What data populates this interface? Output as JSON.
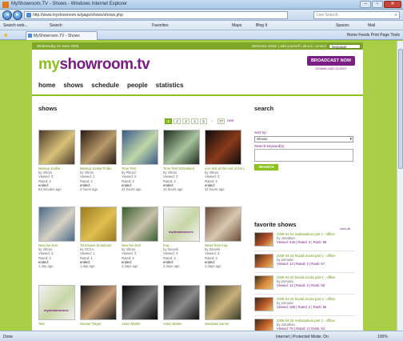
{
  "window": {
    "title": "MyShowroom.TV - Shows - Windows Internet Explorer",
    "address": "http://www.myshowroom.tv/page/shows/shows.php",
    "search_placeholder": "Live Search",
    "tab_label": "MyShowroom.TV - Shows",
    "toolbar_items": [
      "Search web...",
      "Search",
      "Favorites",
      "Maps",
      "Blog It",
      "Spaces",
      "Mail"
    ],
    "tab_commands": "Home  Feeds  Print  Page  Tools",
    "status_left": "Done",
    "status_zone": "Internet | Protected Mode: On",
    "status_zoom": "100%"
  },
  "site": {
    "top_strip_date": "Wednesday 04 June 2008",
    "top_strip_links": "Welcome visitor | add yourself | about | contact",
    "language": "language",
    "logo_my": "my",
    "logo_rest": "showroom.tv",
    "broadcast_label": "BROADCAST NOW",
    "broadcast_sub": "DOWNLOAD CLIENT",
    "nav": [
      "home",
      "shows",
      "schedule",
      "people",
      "statistics"
    ]
  },
  "shows": {
    "heading": "shows",
    "pager": [
      "1",
      "2",
      "3",
      "4",
      "5",
      "...",
      "77",
      "next"
    ],
    "current_page": "1",
    "items": [
      {
        "title": "Meetup Junkie",
        "by": "by Viltoro",
        "views": "Viewed: 3",
        "rated": "Rated: 2",
        "status": "ended:",
        "when": "53 minutes ago",
        "colors": [
          "#4c3a2a",
          "#d9c27a"
        ]
      },
      {
        "title": "Meetup Junkie Probe",
        "by": "by Viltoro",
        "views": "Viewed: 1",
        "rated": "Rated: 2",
        "status": "ended:",
        "when": "2 hours ago",
        "colors": [
          "#2c1b14",
          "#b79a6a"
        ]
      },
      {
        "title": "Time Test",
        "by": "by Pikoyz",
        "views": "Viewed: 0",
        "rated": "Rated: 2",
        "status": "ended:",
        "when": "22 hours ago",
        "colors": [
          "#3a5a8a",
          "#c0d6a8"
        ]
      },
      {
        "title": "Time Test Scheduled",
        "by": "by Viltoro",
        "views": "Viewed: 3",
        "rated": "Rated: 2",
        "status": "ended:",
        "when": "22 hours ago",
        "colors": [
          "#1f2a1e",
          "#a7c49d"
        ]
      },
      {
        "title": "Live test at the end of the day",
        "by": "by Viltoro",
        "views": "Viewed: 3",
        "rated": "Rated: 2",
        "status": "ended:",
        "when": "22 hours ago",
        "colors": [
          "#0d0d0d",
          "#8a3a1a"
        ]
      },
      {
        "title": "New live test",
        "by": "by Viltoro",
        "views": "Viewed: 2",
        "rated": "Rated: 2",
        "status": "ended:",
        "when": "1 day ago",
        "colors": [
          "#4a6a8a",
          "#d7d2c4"
        ]
      },
      {
        "title": "Tourniquet broadcast",
        "by": "by OCCA",
        "views": "Viewed: 1",
        "rated": "Rated: 1",
        "status": "ended:",
        "when": "1 day ago",
        "colors": [
          "#9a7a20",
          "#e0c050"
        ]
      },
      {
        "title": "New live test",
        "by": "by Viltoro",
        "views": "Viewed: 3",
        "rated": "Rated: 2",
        "status": "ended:",
        "when": "2 days ago",
        "colors": [
          "#3a6030",
          "#c6c0a8"
        ]
      },
      {
        "title": "Iraq",
        "by": "by Zanvrik",
        "views": "Viewed: 3",
        "rated": "Rated: 2",
        "status": "ended:",
        "when": "2 days ago",
        "colors": [
          "#f2f2f2",
          "#c8d6a6"
        ]
      },
      {
        "title": "News from Iraq",
        "by": "by Zanvrik",
        "views": "Viewed: 3",
        "rated": "Rated: 2",
        "status": "ended:",
        "when": "2 days ago",
        "colors": [
          "#6a4a3a",
          "#d9c9b0"
        ]
      },
      {
        "title": "Test",
        "by": "",
        "views": "",
        "rated": "",
        "status": "",
        "when": "",
        "colors": [
          "#f2f2f2",
          "#c8d6a6"
        ]
      },
      {
        "title": "Human Target",
        "by": "",
        "views": "",
        "rated": "",
        "status": "",
        "when": "",
        "colors": [
          "#1a1a1a",
          "#c9a07a"
        ]
      },
      {
        "title": "Aston Martin",
        "by": "",
        "views": "",
        "rated": "",
        "status": "",
        "when": "",
        "colors": [
          "#0a0a0a",
          "#7a7a7a"
        ]
      },
      {
        "title": "Aston Martin",
        "by": "",
        "views": "",
        "rated": "",
        "status": "",
        "when": "",
        "colors": [
          "#141414",
          "#8a8a8a"
        ]
      },
      {
        "title": "Windows Server",
        "by": "",
        "views": "",
        "rated": "",
        "status": "",
        "when": "",
        "colors": [
          "#3a3a2a",
          "#c8b07a"
        ]
      }
    ],
    "placeholder_label": "myshowroom.tv"
  },
  "sidebar": {
    "search_heading": "search",
    "sort_label": "Sort by:",
    "select_value": "Shows",
    "keywords_label": "Search keyword(s)",
    "search_button": "SEARCH",
    "favorite_heading": "favorite shows",
    "view_all": "view all",
    "favorites": [
      {
        "name": "2008-04-24 multistadium part 1 - offline",
        "by": "by Jonathan",
        "stats": "Viewed: 446 | Rated: 3 | Rank: 58",
        "color": "#b5502a"
      },
      {
        "name": "2008-04-24 feudal clocks part 1 - offline",
        "by": "by jormusic",
        "stats": "Viewed: 13 | Rated: 2 | Rank: 57",
        "color": "#c66a30"
      },
      {
        "name": "2008-04-25 feudal clocks part 2 - offline",
        "by": "by jormusic",
        "stats": "Viewed: 13 | Rated: 2 | Rank: 56",
        "color": "#d8883a"
      },
      {
        "name": "2008-04-25 feudal clocks part 3 - offline",
        "by": "by jormusic",
        "stats": "Viewed: 188 | Rated: 2 | Rank: 55",
        "color": "#b95a28"
      },
      {
        "name": "2008-04-26 multistadium part 2 - offline",
        "by": "by Jonathan",
        "stats": "Viewed: 75 | Rated: 3 | Rank: 54",
        "color": "#c4622a"
      }
    ]
  }
}
